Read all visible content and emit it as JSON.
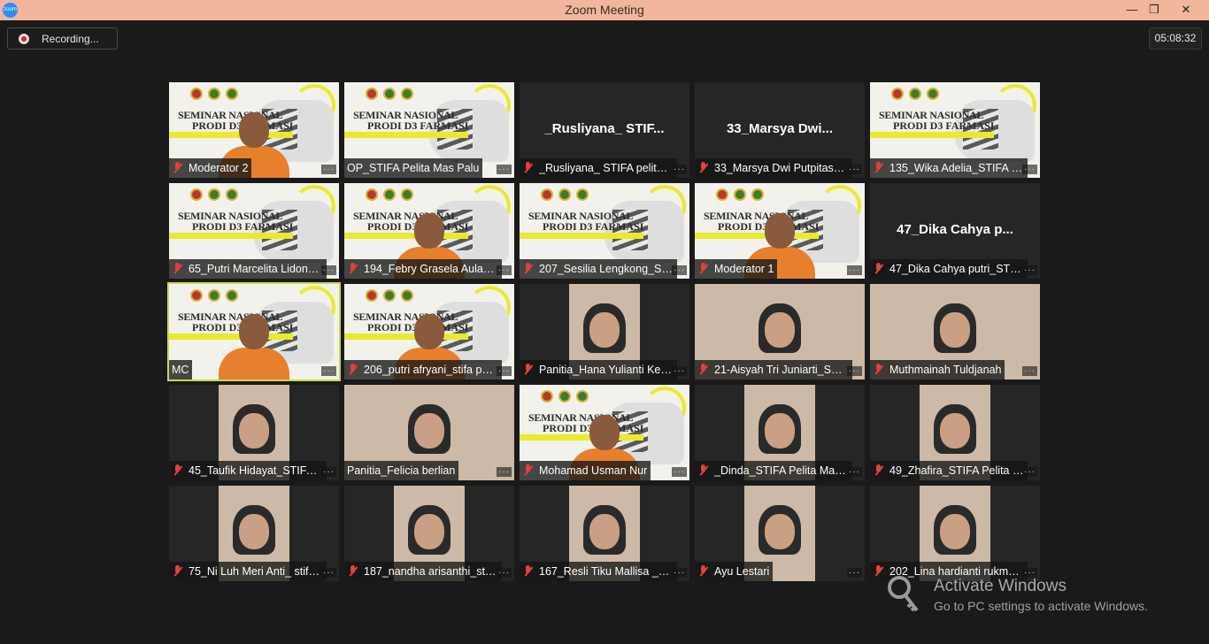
{
  "window": {
    "title": "Zoom Meeting",
    "app_icon_text": "zoom",
    "controls": {
      "minimize": "—",
      "restore": "❐",
      "close": "✕"
    }
  },
  "recording": {
    "label": "Recording..."
  },
  "timer": {
    "value": "05:08:32"
  },
  "participants": [
    {
      "name": "Moderator 2",
      "muted": true,
      "visual": "banner-person"
    },
    {
      "name": "OP_STIFA Pelita Mas Palu",
      "muted": false,
      "visual": "banner"
    },
    {
      "name": "_Rusliyana_ STIFA pelita ma...",
      "big_name": "_Rusliyana_ STIF...",
      "muted": true,
      "visual": "name"
    },
    {
      "name": "33_Marsya Dwi Putpitasari_...",
      "big_name": "33_Marsya Dwi...",
      "muted": true,
      "visual": "name"
    },
    {
      "name": "135_Wika Adelia_STIFA PM ...",
      "muted": true,
      "visual": "banner"
    },
    {
      "name": "65_Putri Marcelita Lidongi_...",
      "muted": true,
      "visual": "banner"
    },
    {
      "name": "194_Febry Grasela Aula_STI...",
      "muted": true,
      "visual": "banner-person"
    },
    {
      "name": "207_Sesilia Lengkong_STIF...",
      "muted": true,
      "visual": "banner"
    },
    {
      "name": "Moderator 1",
      "muted": true,
      "visual": "banner-person"
    },
    {
      "name": "47_Dika Cahya putri_STIFA ...",
      "big_name": "47_Dika Cahya p...",
      "muted": true,
      "visual": "name"
    },
    {
      "name": "MC",
      "muted": false,
      "active": true,
      "visual": "banner-person"
    },
    {
      "name": "206_putri afryani_stifa pm ...",
      "muted": true,
      "visual": "banner-person"
    },
    {
      "name": "Panitia_Hana Yulianti Kenta",
      "muted": true,
      "visual": "camera"
    },
    {
      "name": "21-Aisyah Tri Juniarti_STIFA...",
      "muted": true,
      "visual": "camera-wide"
    },
    {
      "name": "Muthmainah Tuldjanah",
      "muted": true,
      "visual": "camera-wide"
    },
    {
      "name": "45_Taufik Hidayat_STIFA Pel...",
      "muted": true,
      "visual": "camera"
    },
    {
      "name": "Panitia_Felicia berlian",
      "muted": false,
      "visual": "camera-wide"
    },
    {
      "name": "Mohamad Usman Nur",
      "muted": true,
      "visual": "banner-person"
    },
    {
      "name": "_Dinda_STIFA Pelita Mas Palu",
      "muted": true,
      "visual": "camera"
    },
    {
      "name": "49_Zhafira_STIFA Pelita Ma...",
      "muted": true,
      "visual": "camera"
    },
    {
      "name": "75_Ni Luh Meri Anti_ stifa p...",
      "muted": true,
      "visual": "camera"
    },
    {
      "name": "187_nandha arisanthi_stifa ...",
      "muted": true,
      "visual": "camera"
    },
    {
      "name": "167_Resli Tiku Mallisa _STIF...",
      "muted": true,
      "visual": "camera"
    },
    {
      "name": "Ayu Lestari",
      "muted": true,
      "visual": "camera"
    },
    {
      "name": "202_Lina hardianti rukmana...",
      "muted": true,
      "visual": "camera"
    }
  ],
  "banner": {
    "line1": "SEMINAR NASIONAL",
    "line2": "PRODI D3 FARMASI"
  },
  "more_label": "···",
  "watermark": {
    "title": "Activate Windows",
    "subtitle": "Go to PC settings to activate Windows."
  }
}
